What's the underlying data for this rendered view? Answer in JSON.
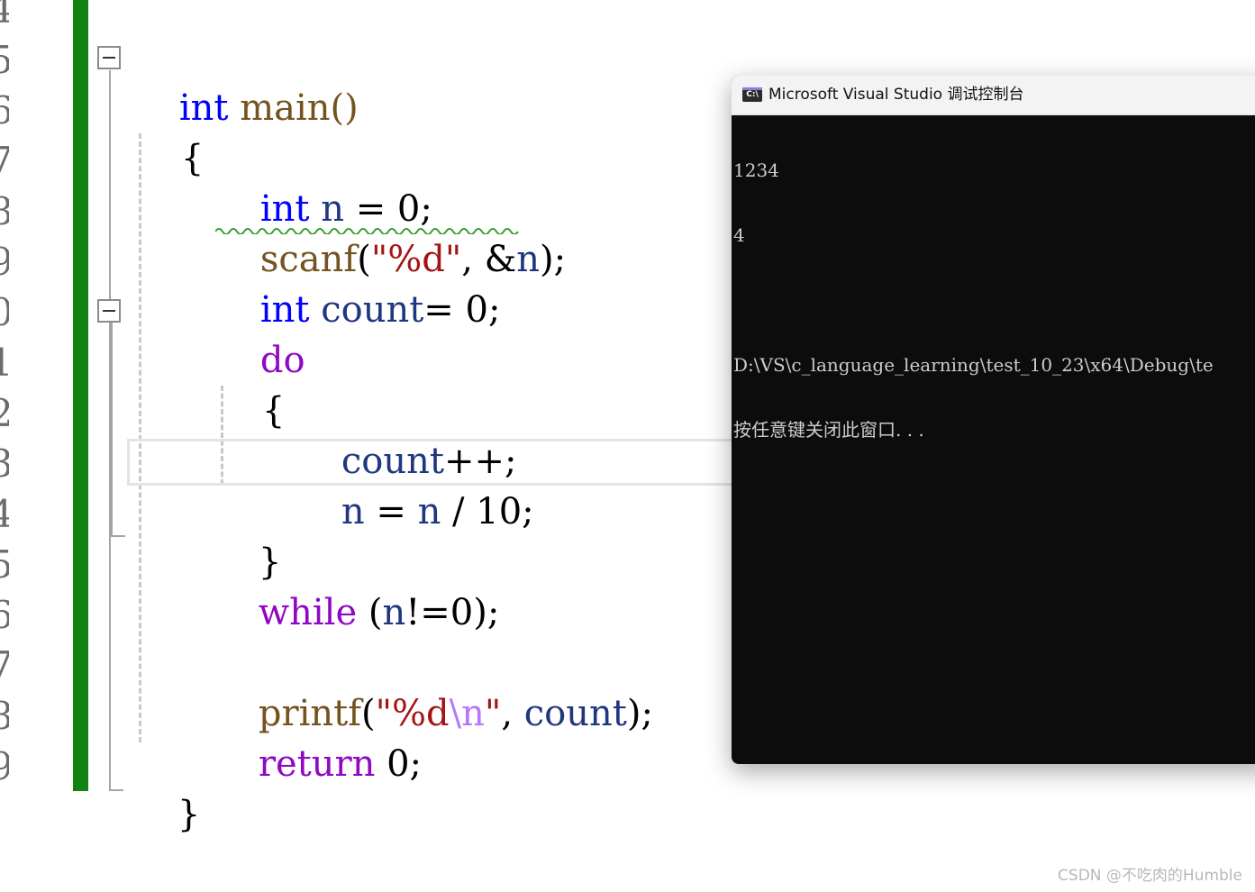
{
  "editor": {
    "line_numbers": [
      "4",
      "5",
      "6",
      "7",
      "8",
      "9",
      "0",
      "1",
      "2",
      "3",
      "4",
      "5",
      "6",
      "7",
      "8",
      "9"
    ],
    "lines": {
      "l1": {
        "kw": "int",
        "rest": " main()"
      },
      "l2": {
        "text": "{"
      },
      "l3": {
        "kw": "int",
        "var": " n",
        "rest": " = 0;"
      },
      "l4": {
        "fn": "scanf",
        "p1": "(",
        "str": "\"%d\"",
        "p2": ", &",
        "var": "n",
        "p3": ");"
      },
      "l5": {
        "kw": "int",
        "var": " count",
        "rest": "= 0;"
      },
      "l6": {
        "kw": "do"
      },
      "l7": {
        "text": "{"
      },
      "l8": {
        "var": "count",
        "rest": "++;"
      },
      "l9": {
        "var1": "n",
        "op": " = ",
        "var2": "n",
        "rest": " / 10;"
      },
      "l10": {
        "text": "}"
      },
      "l11": {
        "kw": "while",
        "p1": " (",
        "var": "n",
        "rest": "!=0);"
      },
      "l12": {
        "fn": "printf",
        "p1": "(",
        "str1": "\"%d",
        "esc": "\\n",
        "str2": "\"",
        "p2": ", ",
        "var": "count",
        "p3": ");"
      },
      "l13": {
        "kw": "return",
        "rest": " 0;"
      },
      "l14": {
        "text": "}"
      }
    },
    "colors": {
      "keyword": "#0000ff",
      "control_keyword": "#8f08c4",
      "function": "#74531f",
      "variable": "#1f377f",
      "string": "#a31515",
      "change_bar": "#128212"
    }
  },
  "console": {
    "icon_label": "C:\\",
    "title": "Microsoft Visual Studio 调试控制台",
    "output": [
      "1234",
      "4",
      "",
      "D:\\VS\\c_language_learning\\test_10_23\\x64\\Debug\\te",
      "按任意键关闭此窗口. . ."
    ]
  },
  "watermark": "CSDN @不吃肉的Humble"
}
